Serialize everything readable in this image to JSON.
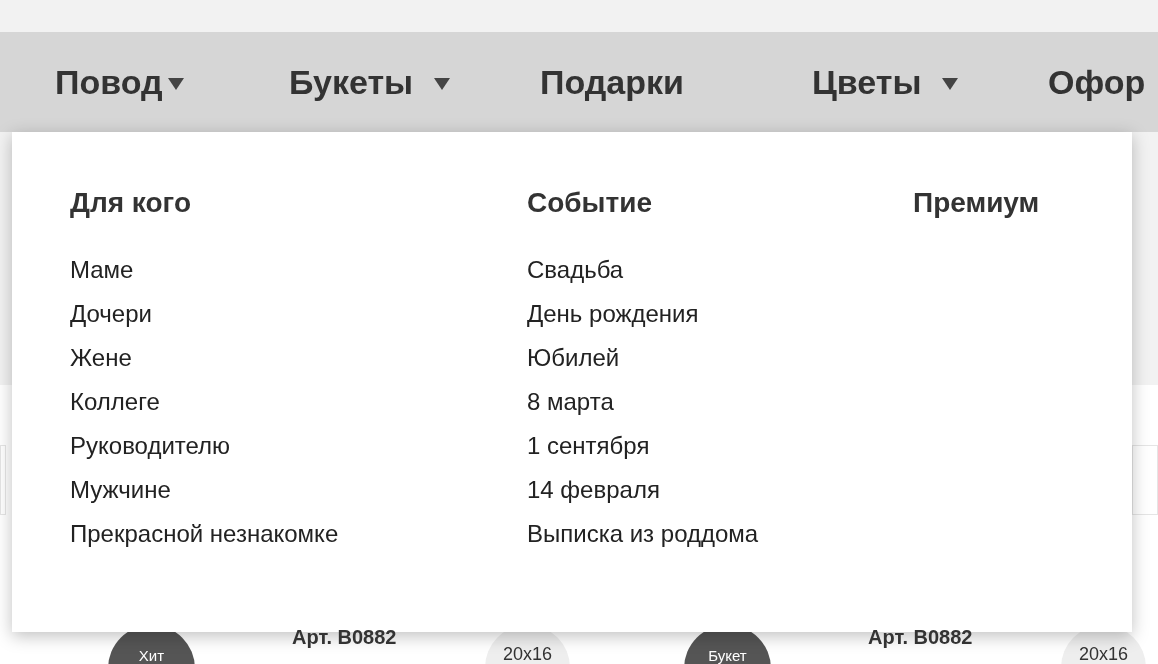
{
  "nav": [
    {
      "label": "Повод",
      "dropdown": true
    },
    {
      "label": "Букеты",
      "dropdown": true
    },
    {
      "label": "Подарки",
      "dropdown": false
    },
    {
      "label": "Цветы",
      "dropdown": true
    },
    {
      "label": "Офор",
      "dropdown": false
    }
  ],
  "menu": {
    "columns": [
      {
        "title": "Для кого",
        "items": [
          "Маме",
          "Дочери",
          "Жене",
          "Коллеге",
          "Руководителю",
          "Мужчине",
          "Прекрасной незнакомке"
        ]
      },
      {
        "title": "Событие",
        "items": [
          "Свадьба",
          "День рождения",
          "Юбилей",
          "8 марта",
          "1 сентября",
          "14 февраля",
          "Выписка из роддома"
        ]
      },
      {
        "title": "Премиум"
      }
    ]
  },
  "products": [
    {
      "badge": "Хит",
      "article": "Арт. B0882",
      "size": "20x16"
    },
    {
      "badge": "Букет",
      "article": "Арт. B0882",
      "size": "20x16"
    }
  ]
}
